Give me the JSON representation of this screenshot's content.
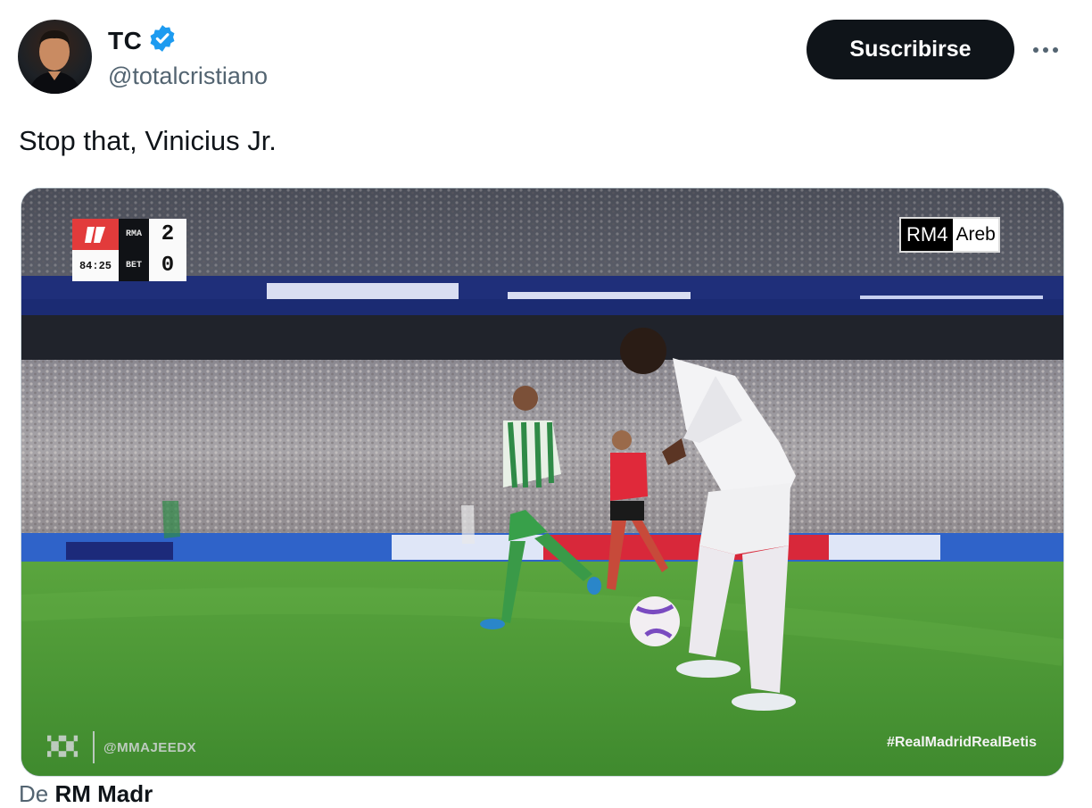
{
  "author": {
    "name": "TC",
    "handle": "@totalcristiano",
    "verified": true
  },
  "actions": {
    "subscribe_label": "Suscribirse",
    "more_icon": "more-horizontal-icon"
  },
  "tweet": {
    "text": "Stop that, Vinicius Jr."
  },
  "media": {
    "scoreboard": {
      "home_team": "RMA",
      "away_team": "BET",
      "home_score": "2",
      "away_score": "0",
      "clock": "84:25"
    },
    "channel": {
      "name": "RM4",
      "suffix": "Areb"
    },
    "watermark_handle": "@MMAJEEDX",
    "hashtag": "#RealMadridRealBetis"
  },
  "footer": {
    "prefix": "De ",
    "source": "RM Madr"
  },
  "colors": {
    "verified": "#1d9bf0",
    "subscribe_bg": "#0f1419",
    "secondary_text": "#536471",
    "pitch": "#4f9a3a"
  }
}
